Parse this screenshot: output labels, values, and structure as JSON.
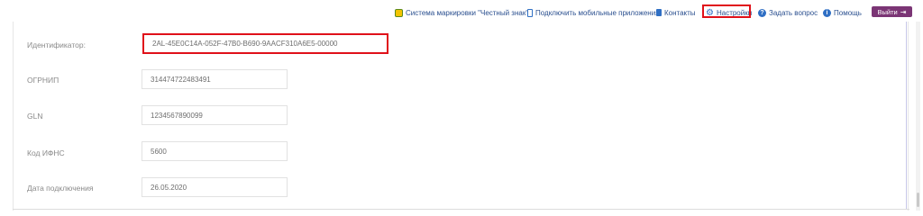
{
  "nav": {
    "honest_sign": "Система маркировки \"Честный знак\"",
    "mobile_apps": "Подключить мобильные приложения",
    "contacts": "Контакты",
    "settings": "Настройки",
    "ask_question": "Задать вопрос",
    "help": "Помощь",
    "logout": "Выйти"
  },
  "icons": {
    "honest_sign": "honest-sign-icon",
    "mobile_apps": "mobile-phone-icon",
    "contacts": "address-book-icon",
    "settings": "gear-icon",
    "ask_question": "question-icon",
    "help": "info-icon",
    "logout": "logout-arrow-icon"
  },
  "colors": {
    "link": "#2a4f8f",
    "highlight": "#e0111a",
    "logout_bg": "#7b3575"
  },
  "fields": [
    {
      "label": "Идентификатор:",
      "value": "2AL-45E0C14A-052F-47B0-B690-9AACF310A6E5-00000"
    },
    {
      "label": "ОГРНИП",
      "value": "314474722483491"
    },
    {
      "label": "GLN",
      "value": "1234567890099"
    },
    {
      "label": "Код ИФНС",
      "value": "5600"
    },
    {
      "label": "Дата подключения",
      "value": "26.05.2020"
    }
  ]
}
